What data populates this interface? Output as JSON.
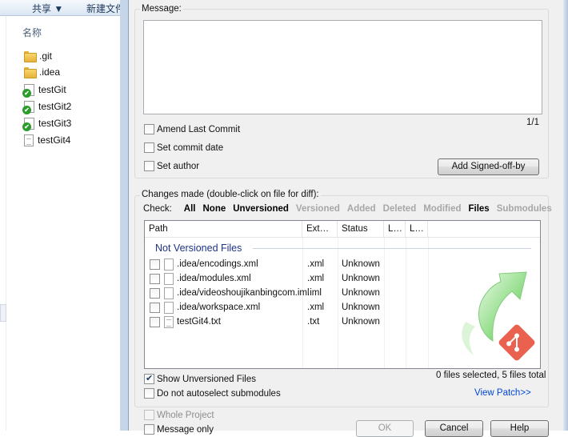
{
  "explorer": {
    "toolbar": {
      "share": "共享 ▼",
      "new_folder": "新建文件"
    },
    "column_header": "名称",
    "files": [
      {
        "name": ".git",
        "icon": "folder-icon"
      },
      {
        "name": ".idea",
        "icon": "folder-icon"
      },
      {
        "name": "testGit",
        "icon": "git-tracked-file-icon"
      },
      {
        "name": "testGit2",
        "icon": "git-tracked-file-icon"
      },
      {
        "name": "testGit3",
        "icon": "git-tracked-file-icon"
      },
      {
        "name": "testGit4",
        "icon": "text-file-icon"
      }
    ]
  },
  "commit": {
    "message_label": "Message:",
    "message_value": "",
    "counter": "1/1",
    "amend_last_commit": {
      "label": "Amend Last Commit",
      "checked": false
    },
    "set_commit_date": {
      "label": "Set commit date",
      "checked": false
    },
    "set_author": {
      "label": "Set author",
      "checked": false
    },
    "add_signed_off_by": "Add Signed-off-by"
  },
  "changes": {
    "label": "Changes made (double-click on file for diff):",
    "check_label": "Check:",
    "filters": [
      {
        "label": "All",
        "enabled": true
      },
      {
        "label": "None",
        "enabled": true
      },
      {
        "label": "Unversioned",
        "enabled": true
      },
      {
        "label": "Versioned",
        "enabled": false
      },
      {
        "label": "Added",
        "enabled": false
      },
      {
        "label": "Deleted",
        "enabled": false
      },
      {
        "label": "Modified",
        "enabled": false
      },
      {
        "label": "Files",
        "enabled": true
      },
      {
        "label": "Submodules",
        "enabled": false
      }
    ],
    "columns": [
      "Path",
      "Ext…",
      "Status",
      "L…",
      "L…"
    ],
    "group_title": "Not Versioned Files",
    "rows": [
      {
        "path": ".idea/encodings.xml",
        "ext": ".xml",
        "status": "Unknown",
        "checked": false
      },
      {
        "path": ".idea/modules.xml",
        "ext": ".xml",
        "status": "Unknown",
        "checked": false
      },
      {
        "path": ".idea/videoshoujikanbingcom.iml",
        "ext": ".iml",
        "status": "Unknown",
        "checked": false
      },
      {
        "path": ".idea/workspace.xml",
        "ext": ".xml",
        "status": "Unknown",
        "checked": false
      },
      {
        "path": "testGit4.txt",
        "ext": ".txt",
        "status": "Unknown",
        "checked": false
      }
    ],
    "show_unversioned": {
      "label": "Show Unversioned Files",
      "checked": true
    },
    "no_autoselect_submodules": {
      "label": "Do not autoselect submodules",
      "checked": false
    },
    "summary": "0 files selected, 5 files total",
    "view_patch": "View Patch>>"
  },
  "bottom": {
    "whole_project": {
      "label": "Whole Project",
      "checked": false,
      "enabled": false
    },
    "message_only": {
      "label": "Message only",
      "checked": false
    },
    "ok": "OK",
    "cancel": "Cancel",
    "help": "Help"
  },
  "colors": {
    "dialog_bg": "#f0f0f0",
    "group_title": "#1e3287",
    "link": "#0046d5",
    "logo_green": "#5cc45c",
    "logo_red": "#e8513c"
  }
}
